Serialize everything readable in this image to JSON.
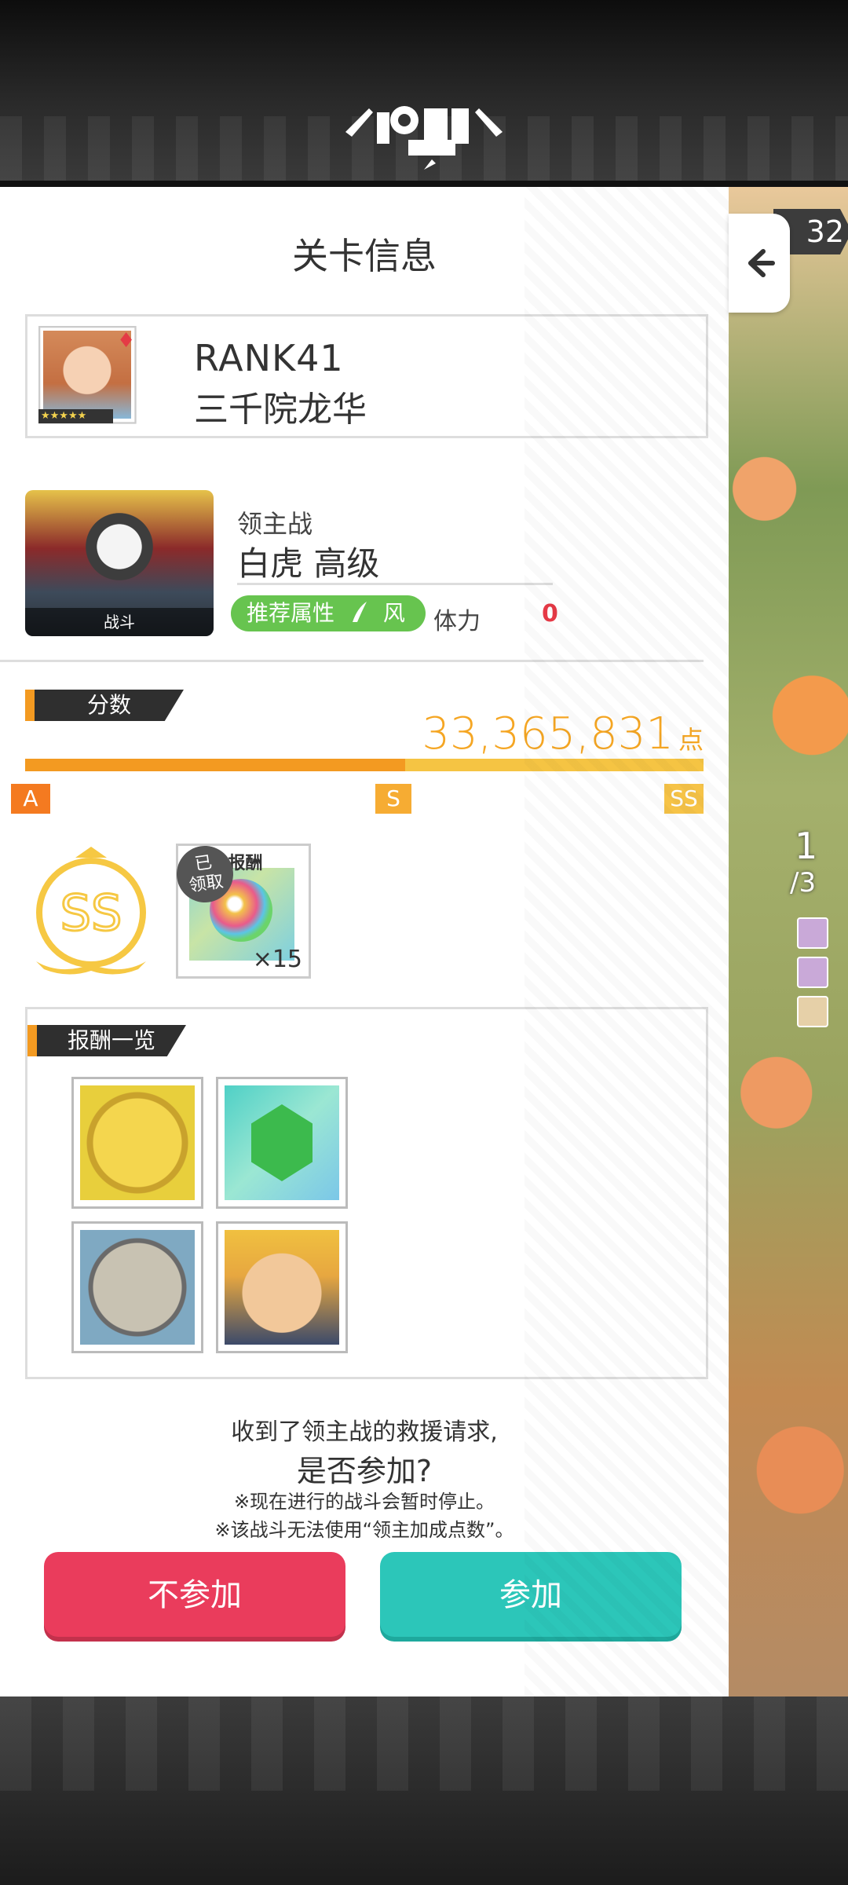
{
  "header": {
    "logo_alt": "弹射物语"
  },
  "side": {
    "rank_badge": "32",
    "page_current": "1",
    "page_total": "/3"
  },
  "panel": {
    "title": "关卡信息",
    "user": {
      "rank": "RANK41",
      "name": "三千院龙华",
      "stars": "★★★★★",
      "suit": "♦"
    },
    "boss": {
      "type": "领主战",
      "name": "白虎 高级",
      "image_label": "战斗",
      "recommended_attr_label": "推荐属性",
      "attr": "风",
      "stamina_label": "体力",
      "stamina_value": "0"
    },
    "score": {
      "label": "分数",
      "value": "33,365,831",
      "unit": "点",
      "progress": 0.56,
      "ranks": [
        "A",
        "S",
        "SS"
      ]
    },
    "rank_medal": "SS",
    "first_reward": {
      "header": "S 报酬",
      "claimed_line1": "已",
      "claimed_line2": "领取",
      "quantity": "×15"
    },
    "reward_list": {
      "label": "报酬一览",
      "items": [
        "gold-coin-icon",
        "green-gem-icon",
        "silver-coin-icon",
        "character-cat-icon"
      ]
    },
    "message": {
      "line1": "收到了领主战的救援请求,",
      "line2": "是否参加?",
      "note1": "※现在进行的战斗会暂时停止。",
      "note2": "※该战斗无法使用“领主加成点数”。"
    },
    "buttons": {
      "decline": "不参加",
      "join": "参加"
    }
  },
  "colors": {
    "accent_orange": "#f39a21",
    "score": "#f5a623",
    "decline": "#ea3c5c",
    "join": "#2cc6b9",
    "wind": "#67c44f"
  }
}
